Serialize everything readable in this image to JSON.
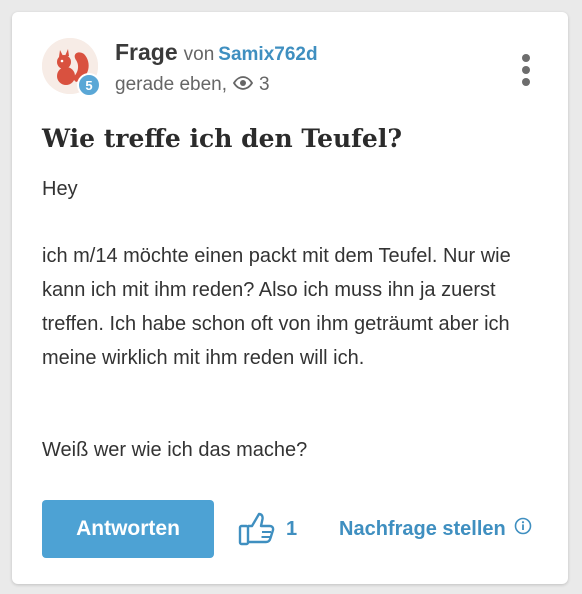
{
  "post": {
    "type_label": "Frage",
    "von_label": "von",
    "username": "Samix762d",
    "user_level": "5",
    "timestamp": "gerade eben,",
    "view_count": "3",
    "title": "Wie treffe ich den Teufel?",
    "paragraphs": [
      "Hey",
      "ich m/14 möchte einen packt mit dem Teufel. Nur wie kann ich mit ihm reden? Also ich muss ihn ja zuerst treffen. Ich habe schon oft von ihm geträumt aber ich meine wirklich mit ihm reden will ich.",
      "Weiß wer wie ich das mache?"
    ]
  },
  "actions": {
    "answer_label": "Antworten",
    "like_count": "1",
    "nachfrage_label": "Nachfrage stellen"
  },
  "icons": {
    "avatar": "squirrel-avatar",
    "views": "eye-icon",
    "more": "more-vertical-icon",
    "like": "thumbs-up-icon",
    "info": "info-icon"
  },
  "colors": {
    "accent": "#4da2d4",
    "link": "#3f8fc0",
    "avatar_red": "#d9513f",
    "level_badge": "#5aa7d6"
  }
}
